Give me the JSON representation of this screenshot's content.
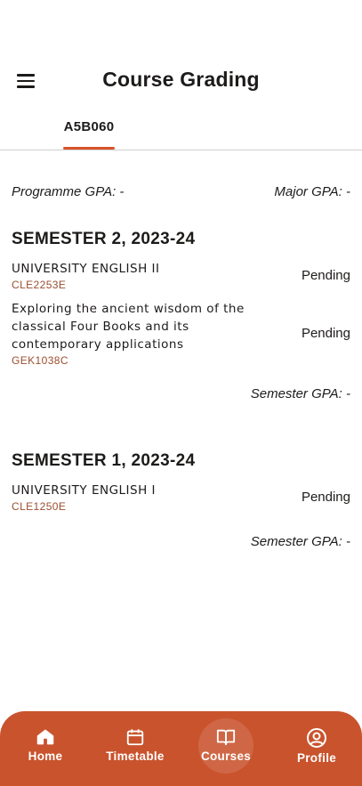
{
  "header": {
    "title": "Course Grading"
  },
  "tabs": [
    {
      "label": "A5B060"
    }
  ],
  "gpa": {
    "programme": "Programme GPA: -",
    "major": "Major GPA: -"
  },
  "semesters": [
    {
      "title": "SEMESTER 2, 2023-24",
      "courses": [
        {
          "name": "UNIVERSITY ENGLISH II",
          "code": "CLE2253E",
          "status": "Pending"
        },
        {
          "name": "Exploring the ancient wisdom of the classical Four Books and its contemporary applications",
          "code": "GEK1038C",
          "status": "Pending"
        }
      ],
      "gpa": "Semester GPA: -"
    },
    {
      "title": "SEMESTER 1, 2023-24",
      "courses": [
        {
          "name": "UNIVERSITY ENGLISH I",
          "code": "CLE1250E",
          "status": "Pending"
        }
      ],
      "gpa": "Semester GPA: -"
    }
  ],
  "nav": {
    "items": [
      {
        "label": "Home",
        "icon": "home-icon"
      },
      {
        "label": "Timetable",
        "icon": "calendar-icon"
      },
      {
        "label": "Courses",
        "icon": "book-icon",
        "active": true
      },
      {
        "label": "Profile",
        "icon": "profile-icon"
      }
    ]
  },
  "colors": {
    "accent": "#c9532d",
    "code": "#9a4e2f"
  }
}
